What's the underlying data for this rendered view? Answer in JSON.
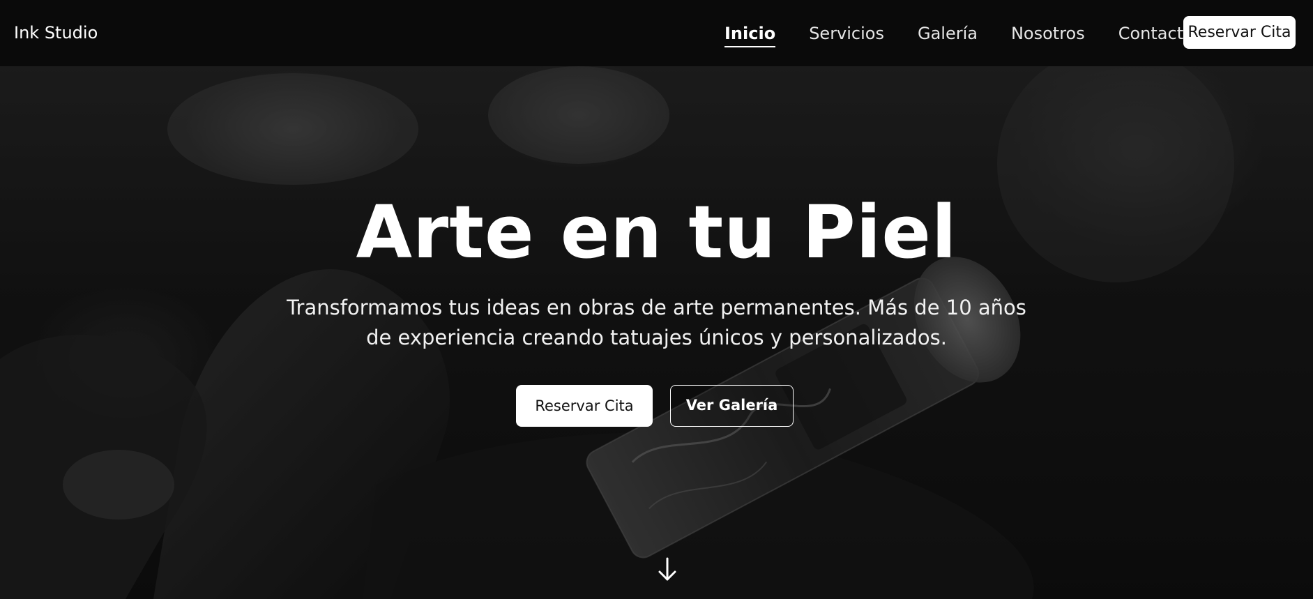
{
  "header": {
    "brand": "Ink Studio",
    "nav": [
      {
        "label": "Inicio",
        "active": true
      },
      {
        "label": "Servicios",
        "active": false
      },
      {
        "label": "Galería",
        "active": false
      },
      {
        "label": "Nosotros",
        "active": false
      },
      {
        "label": "Contacto",
        "active": false
      }
    ],
    "cta_label": "Reservar Cita"
  },
  "hero": {
    "title": "Arte en tu Piel",
    "subtitle": "Transformamos tus ideas en obras de arte permanentes. Más de 10 años de experiencia creando tatuajes únicos y personalizados.",
    "primary_button": "Reservar Cita",
    "secondary_button": "Ver Galería",
    "scroll_icon": "arrow-down-icon",
    "background_image": "tattoo-machine-photo"
  },
  "colors": {
    "header_bg": "#0a0a0a",
    "button_bg": "#ffffff",
    "button_text": "#111111",
    "text": "#ffffff"
  }
}
